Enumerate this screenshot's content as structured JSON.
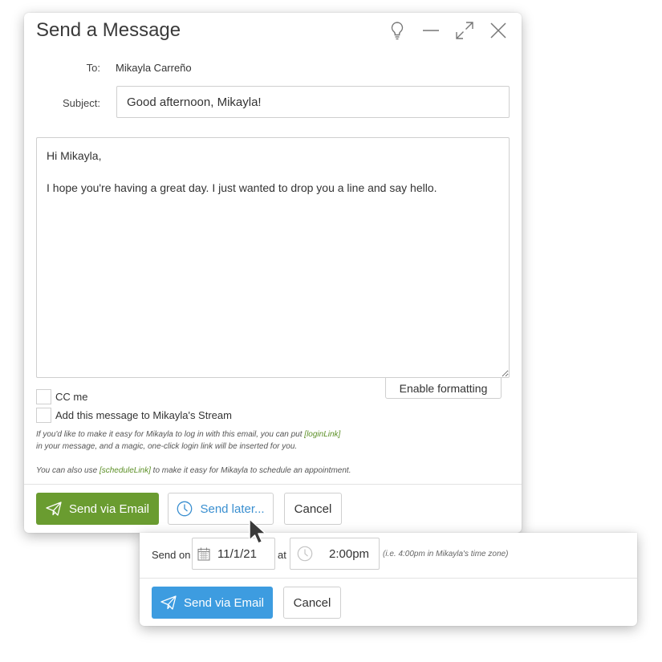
{
  "dialog": {
    "title": "Send a Message",
    "icons": [
      "lightbulb-icon",
      "minimize-icon",
      "expand-icon",
      "close-icon"
    ],
    "to_label": "To:",
    "to_value": "Mikayla Carreño",
    "subject_label": "Subject:",
    "subject_value": "Good afternoon, Mikayla!",
    "body_value": "Hi Mikayla,\n\nI hope you're having a great day. I just wanted to drop you a line and say hello.",
    "enable_formatting": "Enable formatting",
    "cc_label": "CC me",
    "stream_label": "Add this message to Mikayla's Stream",
    "help1_a": "If you'd like to make it easy for Mikayla to log in with this email, you can put ",
    "help1_tag": "[loginLink]",
    "help1_b": "in your message, and a magic, one-click login link will be inserted for you.",
    "help2_a": "You can also use ",
    "help2_tag": "[scheduleLink]",
    "help2_b": " to make it easy for Mikayla to schedule an appointment.",
    "send_email": "Send via Email",
    "send_later": "Send later...",
    "cancel": "Cancel"
  },
  "schedule": {
    "send_on_label": "Send on",
    "date_value": "11/1/21",
    "at_label": "at",
    "time_value": "2:00pm",
    "tz_note": "(i.e. 4:00pm in Mikayla's time zone)",
    "send_email": "Send via Email",
    "cancel": "Cancel"
  },
  "colors": {
    "send_green": "#6a9c30",
    "send_blue": "#3d9ce0",
    "link_blue": "#3a8fd0",
    "tag_green": "#5b8f25"
  }
}
